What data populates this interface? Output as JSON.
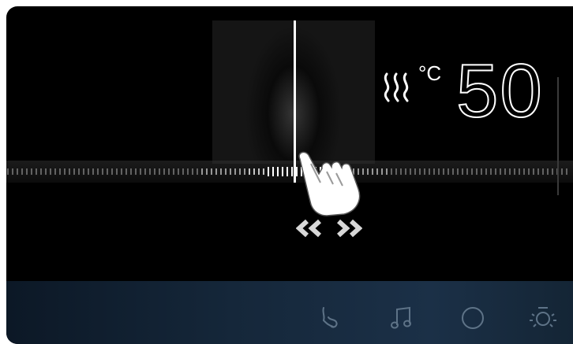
{
  "readout": {
    "unit": "°C",
    "value": "50",
    "mode_icon": "heat-waves-icon"
  },
  "gesture": {
    "hand_icon": "swipe-hand-icon",
    "arrows_icon": "left-right-arrows-icon"
  },
  "bottom_icons": [
    {
      "name": "massage-icon"
    },
    {
      "name": "music-note-icon"
    },
    {
      "name": "circle-icon"
    },
    {
      "name": "light-icon"
    }
  ],
  "colors": {
    "background": "#000000",
    "indicator": "#ffffff",
    "bottom_bar": "#16283b"
  }
}
